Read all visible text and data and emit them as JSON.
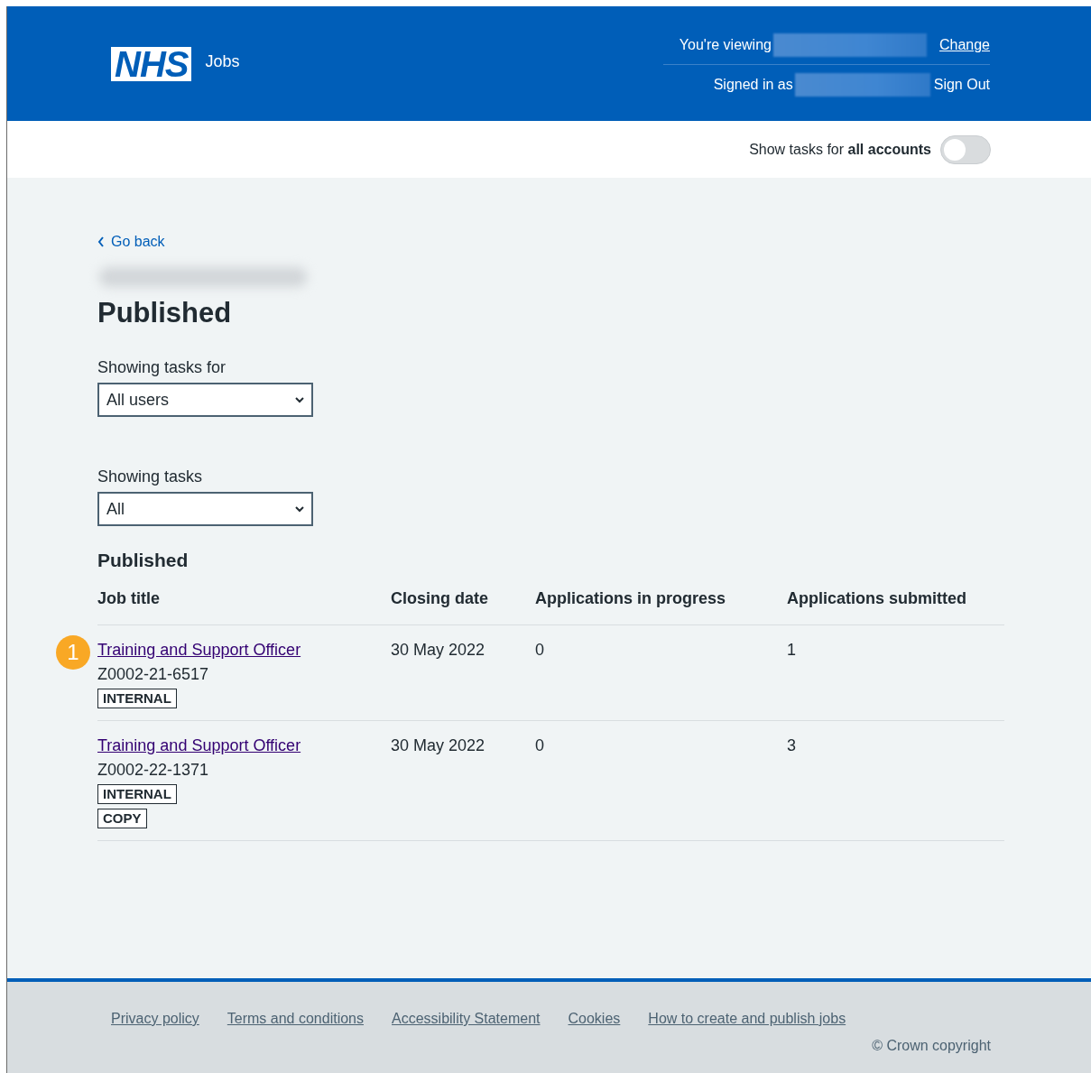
{
  "header": {
    "logo": "NHS",
    "service": "Jobs",
    "viewing_label": "You're viewing",
    "change_link": "Change",
    "signed_in_label": "Signed in as",
    "sign_out_link": "Sign Out"
  },
  "toggle": {
    "label": "Show tasks for **all accounts**",
    "on": false
  },
  "back_link": "Go back",
  "heading": "Published",
  "filters": [
    {
      "label": "Showing tasks for",
      "value": "All users"
    },
    {
      "label": "Showing tasks",
      "value": "All"
    }
  ],
  "table": {
    "caption": "Published",
    "columns": [
      "Job title",
      "Closing date",
      "Applications in progress",
      "Applications submitted"
    ],
    "rows": [
      {
        "title": "Training and Support Officer",
        "reference": "Z0002-21-6517",
        "tags": [
          "INTERNAL"
        ],
        "closing_date": "30 May 2022",
        "in_progress": "0",
        "submitted": "1",
        "callout": "1"
      },
      {
        "title": "Training and Support Officer",
        "reference": "Z0002-22-1371",
        "tags": [
          "INTERNAL",
          "COPY"
        ],
        "closing_date": "30 May 2022",
        "in_progress": "0",
        "submitted": "3"
      }
    ]
  },
  "footer": {
    "links": [
      "Privacy policy",
      "Terms and conditions",
      "Accessibility Statement",
      "Cookies",
      "How to create and publish jobs"
    ],
    "copyright": "© Crown copyright"
  }
}
